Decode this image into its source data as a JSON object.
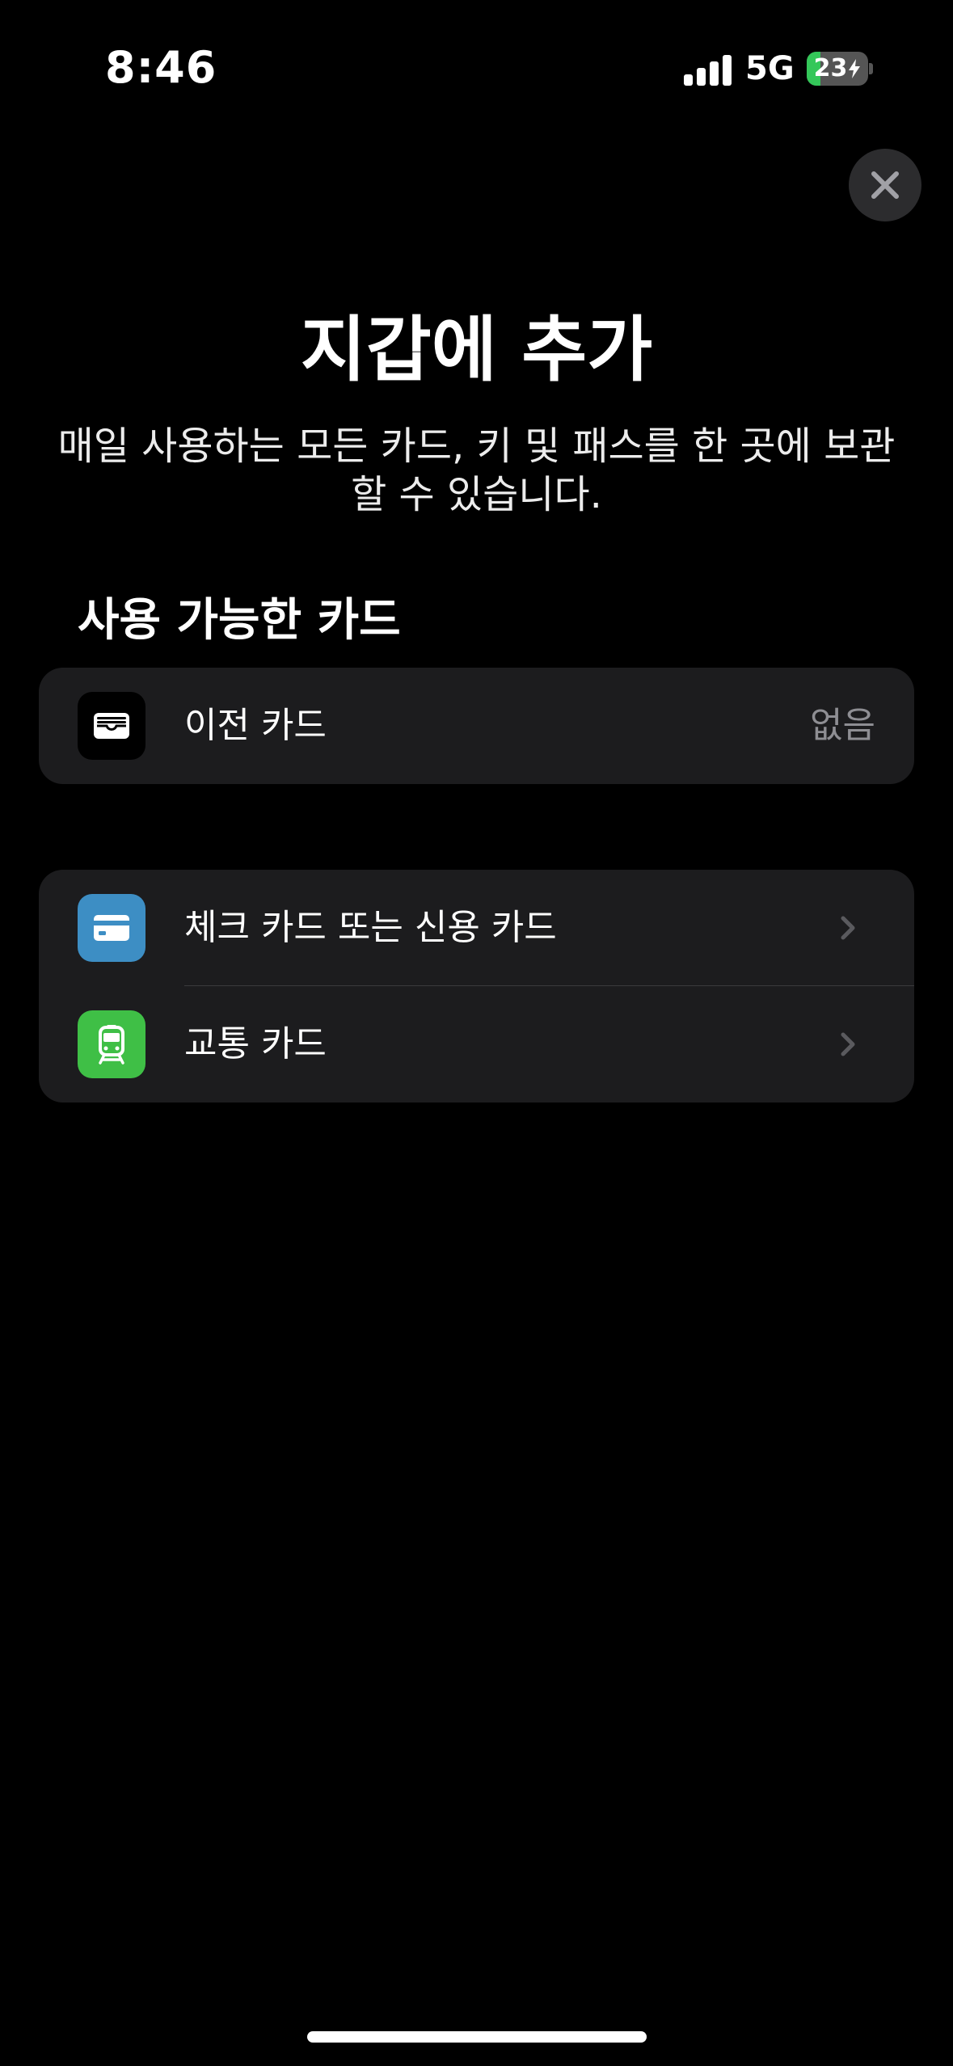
{
  "status_bar": {
    "time": "8:46",
    "network": "5G",
    "battery_level": "23",
    "battery_fraction": 0.23,
    "charging": true
  },
  "close_button": {
    "icon": "close-icon"
  },
  "page": {
    "title": "지갑에 추가",
    "subtitle": "매일 사용하는 모든 카드, 키 및 패스를 한 곳에 보관할 수 있습니다."
  },
  "available_cards": {
    "header": "사용 가능한 카드",
    "previous_cards": {
      "label": "이전 카드",
      "value": "없음",
      "icon": "wallet-icon"
    }
  },
  "add_options": [
    {
      "label": "체크 카드 또는 신용 카드",
      "icon": "credit-card-icon",
      "icon_bg": "#3d8ec4"
    },
    {
      "label": "교통 카드",
      "icon": "train-icon",
      "icon_bg": "#3fbf46"
    }
  ],
  "colors": {
    "background": "#000000",
    "grouped_bg": "#1c1c1e",
    "secondary_text": "#8e8e93",
    "battery_green": "#34c759"
  }
}
